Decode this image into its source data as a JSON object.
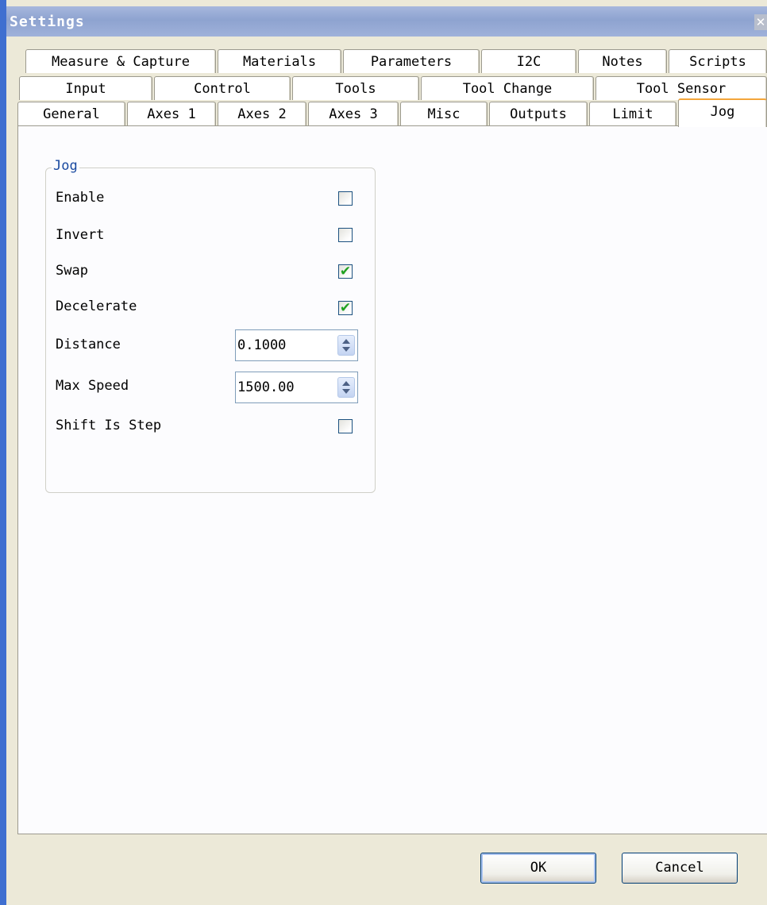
{
  "window": {
    "title": "Settings",
    "close_glyph": "✕"
  },
  "tabs": {
    "row_top": [
      "Measure & Capture",
      "Materials",
      "Parameters",
      "I2C",
      "Notes",
      "Scripts"
    ],
    "row_middle": [
      "Input",
      "Control",
      "Tools",
      "Tool Change",
      "Tool Sensor"
    ],
    "row_bottom": [
      "General",
      "Axes 1",
      "Axes 2",
      "Axes 3",
      "Misc",
      "Outputs",
      "Limit",
      "Jog"
    ],
    "active": "Jog"
  },
  "jog_group": {
    "legend": "Jog",
    "enable": {
      "label": "Enable",
      "checked": false
    },
    "invert": {
      "label": "Invert",
      "checked": false
    },
    "swap": {
      "label": "Swap",
      "checked": true
    },
    "decelerate": {
      "label": "Decelerate",
      "checked": true
    },
    "distance": {
      "label": "Distance",
      "value": "0.1000"
    },
    "max_speed": {
      "label": "Max Speed",
      "value": "1500.00"
    },
    "shift_is_step": {
      "label": "Shift Is Step",
      "checked": false
    }
  },
  "footer": {
    "ok_label": "OK",
    "cancel_label": "Cancel"
  },
  "colors": {
    "active_tab_accent": "#f3a53a",
    "group_legend": "#1a4aa0",
    "check": "#21a121"
  },
  "icons": {
    "close": "close-icon",
    "check": "checkmark-icon",
    "spin": "spin-arrows-icon"
  }
}
